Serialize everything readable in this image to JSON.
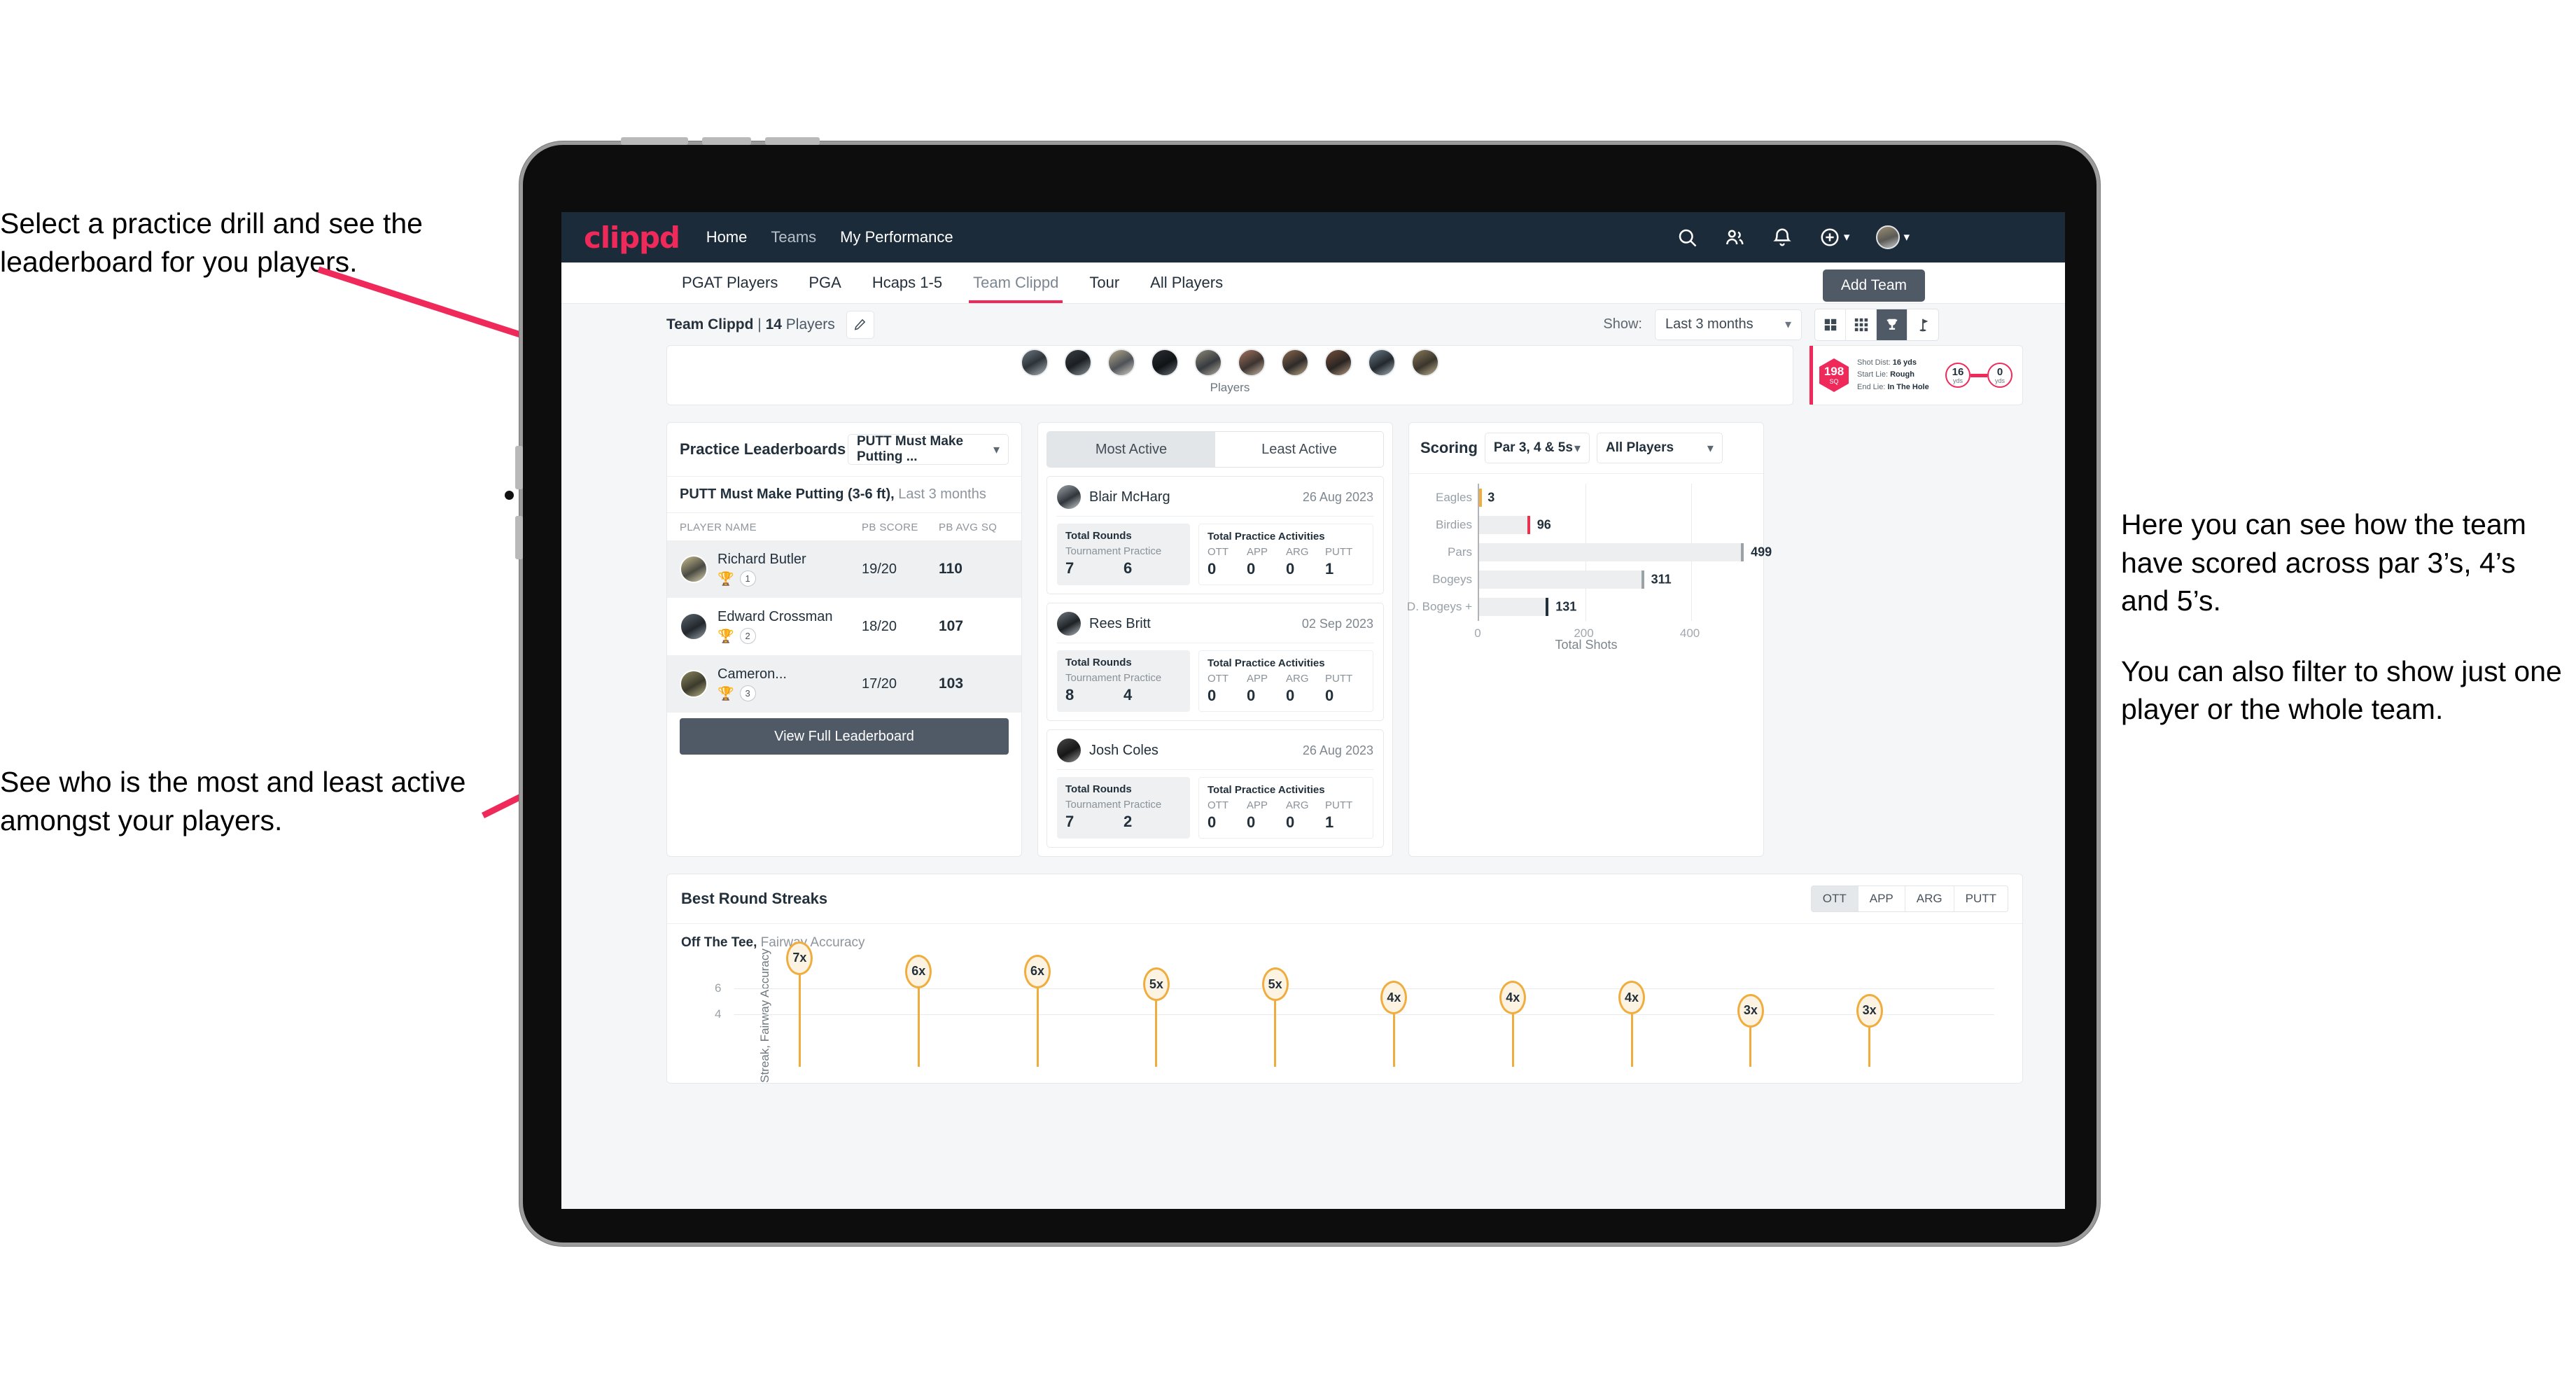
{
  "annotations": {
    "left_top": "Select a practice drill and see the leaderboard for you players.",
    "left_bottom": "See who is the most and least active amongst your players.",
    "right_1": "Here you can see how the team have scored across par 3’s, 4’s and 5’s.",
    "right_2": "You can also filter to show just one player or the whole team."
  },
  "topnav": {
    "logo": "clippd",
    "links": [
      "Home",
      "Teams",
      "My Performance"
    ],
    "icons": [
      "search-icon",
      "people-icon",
      "bell-icon",
      "plus-circle-icon",
      "avatar"
    ]
  },
  "tabs": [
    {
      "label": "PGAT Players",
      "active": false
    },
    {
      "label": "PGA",
      "active": false
    },
    {
      "label": "Hcaps 1-5",
      "active": false
    },
    {
      "label": "Team Clippd",
      "active": true
    },
    {
      "label": "Tour",
      "active": false
    },
    {
      "label": "All Players",
      "active": false
    }
  ],
  "add_team_button": "Add Team",
  "subbar": {
    "team_name": "Team Clippd",
    "separator": " | ",
    "player_count": "14",
    "players_word": " Players",
    "show_label": "Show:",
    "show_value": "Last 3 months",
    "view_icons": [
      "grid-large-icon",
      "grid-small-icon",
      "trophy-icon",
      "flag-icon"
    ],
    "view_active_index": 2
  },
  "players_strip": {
    "caption": "Players",
    "avatar_count": 10
  },
  "shot_card": {
    "sq_value": "198",
    "sq_label": "SQ",
    "lines": [
      {
        "label": "Shot Dist:",
        "value": "16 yds"
      },
      {
        "label": "Start Lie:",
        "value": "Rough"
      },
      {
        "label": "End Lie:",
        "value": "In The Hole"
      }
    ],
    "start_dist": "16",
    "start_unit": "yds",
    "end_dist": "0",
    "end_unit": "yds"
  },
  "leaderboard": {
    "title": "Practice Leaderboards",
    "drill_select": "PUTT Must Make Putting ...",
    "subtitle_bold": "PUTT Must Make Putting (3-6 ft),",
    "subtitle_rest": " Last 3 months",
    "columns": [
      "PLAYER NAME",
      "PB SCORE",
      "PB AVG SQ"
    ],
    "rows": [
      {
        "name": "Richard Butler",
        "rank": "1",
        "trophy": "gold",
        "score": "19/20",
        "sq": "110"
      },
      {
        "name": "Edward Crossman",
        "rank": "2",
        "trophy": "silver",
        "score": "18/20",
        "sq": "107"
      },
      {
        "name": "Cameron...",
        "rank": "3",
        "trophy": "bronze",
        "score": "17/20",
        "sq": "103"
      }
    ],
    "button": "View Full Leaderboard"
  },
  "activity": {
    "tabs": [
      {
        "label": "Most Active",
        "active": true
      },
      {
        "label": "Least Active",
        "active": false
      }
    ],
    "block_rounds_title": "Total Rounds",
    "block_practice_title": "Total Practice Activities",
    "rounds_keys": [
      "Tournament",
      "Practice"
    ],
    "practice_keys": [
      "OTT",
      "APP",
      "ARG",
      "PUTT"
    ],
    "items": [
      {
        "name": "Blair McHarg",
        "date": "26 Aug 2023",
        "rounds": [
          "7",
          "6"
        ],
        "practice": [
          "0",
          "0",
          "0",
          "1"
        ]
      },
      {
        "name": "Rees Britt",
        "date": "02 Sep 2023",
        "rounds": [
          "8",
          "4"
        ],
        "practice": [
          "0",
          "0",
          "0",
          "0"
        ]
      },
      {
        "name": "Josh Coles",
        "date": "26 Aug 2023",
        "rounds": [
          "7",
          "2"
        ],
        "practice": [
          "0",
          "0",
          "0",
          "1"
        ]
      }
    ]
  },
  "scoring": {
    "title": "Scoring",
    "par_select": "Par 3, 4 & 5s",
    "player_select": "All Players"
  },
  "streaks": {
    "title": "Best Round Streaks",
    "toggle": [
      {
        "label": "OTT",
        "active": true
      },
      {
        "label": "APP",
        "active": false
      },
      {
        "label": "ARG",
        "active": false
      },
      {
        "label": "PUTT",
        "active": false
      }
    ],
    "sub_bold": "Off The Tee,",
    "sub_rest": " Fairway Accuracy"
  },
  "colors": {
    "brand_pink": "#ef2a5b",
    "nav_dark": "#1b2b3a",
    "slate": "#4f5a66",
    "amber": "#f0ad3e",
    "bar_gray": "#eceef0"
  },
  "chart_data": [
    {
      "type": "bar",
      "orientation": "horizontal",
      "title": "Scoring",
      "categories": [
        "Eagles",
        "Birdies",
        "Pars",
        "Bogeys",
        "D. Bogeys +"
      ],
      "values": [
        3,
        96,
        499,
        311,
        131
      ],
      "end_cap_colors": [
        "#f0ad3e",
        "#e8324f",
        "#9aa1a7",
        "#9aa1a7",
        "#22303c"
      ],
      "xlabel": "Total Shots",
      "ylabel": "",
      "xticks": [
        0,
        200,
        400
      ],
      "xlim": [
        0,
        520
      ],
      "grid": true,
      "legend": "none"
    },
    {
      "type": "scatter",
      "subtype": "lollipop",
      "title": "Best Round Streaks",
      "series_label": "Off The Tee, Fairway Accuracy",
      "ylabel": "Streak, Fairway Accuracy",
      "values": [
        7,
        6,
        6,
        5,
        5,
        4,
        4,
        4,
        3,
        3
      ],
      "labels": [
        "7x",
        "6x",
        "6x",
        "5x",
        "5x",
        "4x",
        "4x",
        "4x",
        "3x",
        "3x"
      ],
      "yticks": [
        4,
        6
      ],
      "ylim": [
        0,
        8
      ],
      "grid": true
    }
  ]
}
